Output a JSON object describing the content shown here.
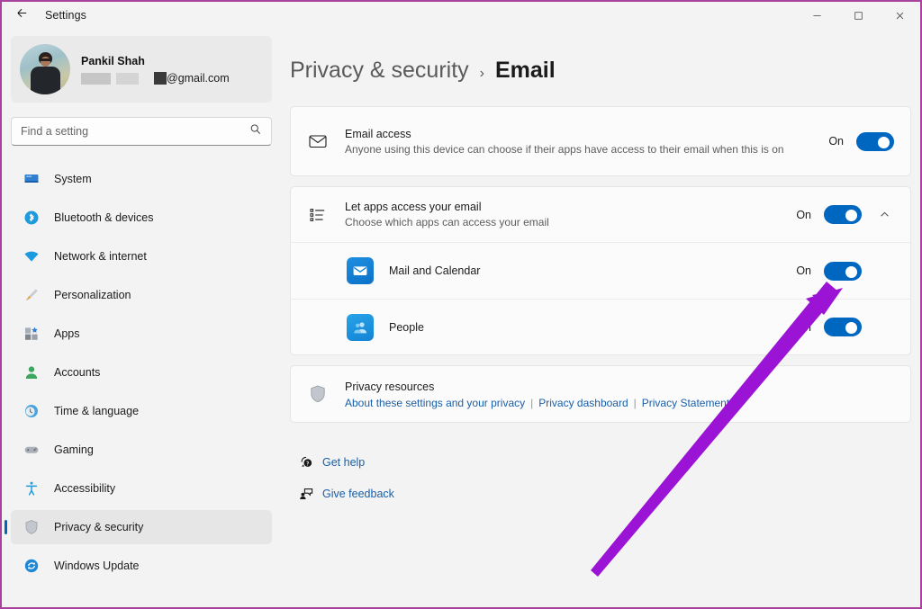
{
  "window": {
    "title": "Settings",
    "back_icon": "back-arrow-icon",
    "minimize_label": "–",
    "maximize_label": "□",
    "close_label": "✕",
    "border_color": "#a8429a"
  },
  "sidebar": {
    "profile": {
      "name": "Pankil Shah",
      "email_domain": "@gmail.com",
      "avatar_name": "user-avatar"
    },
    "search": {
      "placeholder": "Find a setting",
      "value": "",
      "icon": "search-icon"
    },
    "items": [
      {
        "label": "System",
        "icon": "system-icon",
        "selected": false
      },
      {
        "label": "Bluetooth & devices",
        "icon": "bluetooth-icon",
        "selected": false
      },
      {
        "label": "Network & internet",
        "icon": "network-icon",
        "selected": false
      },
      {
        "label": "Personalization",
        "icon": "personalization-icon",
        "selected": false
      },
      {
        "label": "Apps",
        "icon": "apps-icon",
        "selected": false
      },
      {
        "label": "Accounts",
        "icon": "accounts-icon",
        "selected": false
      },
      {
        "label": "Time & language",
        "icon": "time-language-icon",
        "selected": false
      },
      {
        "label": "Gaming",
        "icon": "gaming-icon",
        "selected": false
      },
      {
        "label": "Accessibility",
        "icon": "accessibility-icon",
        "selected": false
      },
      {
        "label": "Privacy & security",
        "icon": "shield-icon",
        "selected": true
      },
      {
        "label": "Windows Update",
        "icon": "windows-update-icon",
        "selected": false
      }
    ]
  },
  "breadcrumb": {
    "parent": "Privacy & security",
    "separator": "›",
    "current": "Email"
  },
  "main": {
    "email_access": {
      "icon": "envelope-icon",
      "title": "Email access",
      "description": "Anyone using this device can choose if their apps have access to their email when this is on",
      "toggle_label": "On",
      "toggle_state": "on"
    },
    "let_apps": {
      "icon": "list-icon",
      "title": "Let apps access your email",
      "description": "Choose which apps can access your email",
      "toggle_label": "On",
      "toggle_state": "on",
      "expand_icon": "chevron-up-icon",
      "expanded": true
    },
    "apps": [
      {
        "name": "Mail and Calendar",
        "icon": "mail-app-icon",
        "toggle_label": "On",
        "toggle_state": "on"
      },
      {
        "name": "People",
        "icon": "people-app-icon",
        "toggle_label": "On",
        "toggle_state": "on"
      }
    ],
    "privacy_resources": {
      "icon": "shield-icon",
      "title": "Privacy resources",
      "links": [
        "About these settings and your privacy",
        "Privacy dashboard",
        "Privacy Statement"
      ],
      "separator": "|"
    },
    "footer_links": [
      {
        "label": "Get help",
        "icon": "help-icon"
      },
      {
        "label": "Give feedback",
        "icon": "feedback-icon"
      }
    ]
  },
  "annotation": {
    "arrow_color": "#9b13d4",
    "points_at": "Mail and Calendar toggle"
  },
  "colors": {
    "accent": "#0067c0",
    "link": "#1a5fa8",
    "selected_bg": "#e6e6e6",
    "card_bg": "#fbfbfb",
    "page_bg": "#f3f3f3"
  }
}
